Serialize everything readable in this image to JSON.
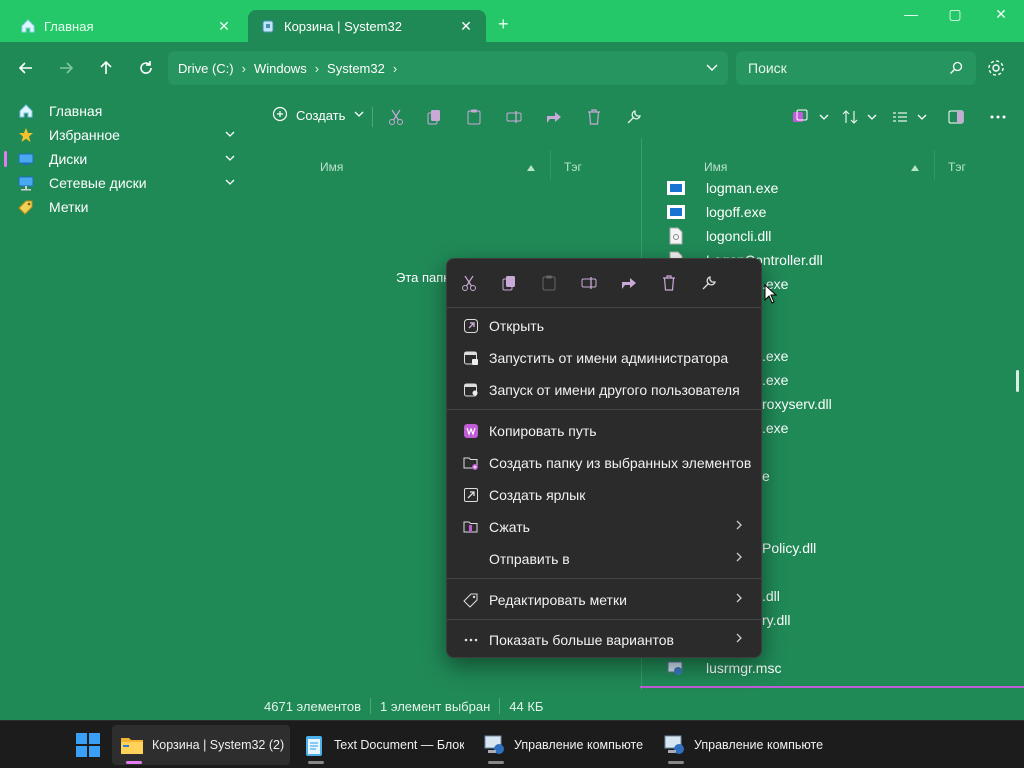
{
  "tabs": [
    {
      "label": "Главная",
      "close": "✕",
      "active": false
    },
    {
      "label": "Корзина | System32",
      "close": "✕",
      "active": true
    }
  ],
  "new_tab": "+",
  "window_buttons": {
    "minimize": "—",
    "maximize": "▢",
    "close": "✕"
  },
  "breadcrumb": [
    "Drive (C:)",
    "Windows",
    "System32"
  ],
  "search": {
    "placeholder": "Поиск"
  },
  "sidebar": {
    "items": [
      {
        "label": "Главная",
        "icon": "home-icon"
      },
      {
        "label": "Избранное",
        "icon": "star-icon",
        "expandable": true
      },
      {
        "label": "Диски",
        "icon": "drive-icon",
        "expandable": true,
        "selected": true
      },
      {
        "label": "Сетевые диски",
        "icon": "network-drive-icon",
        "expandable": true
      },
      {
        "label": "Метки",
        "icon": "tag-icon"
      }
    ]
  },
  "toolbar": {
    "create_label": "Создать"
  },
  "left_pane": {
    "col_name": "Имя",
    "col_tag": "Тэг",
    "empty_text": "Эта папка"
  },
  "right_pane": {
    "col_name": "Имя",
    "col_tag": "Тэг",
    "files": [
      {
        "name": "logman.exe",
        "icon": "exe-icon"
      },
      {
        "name": "logoff.exe",
        "icon": "exe-icon"
      },
      {
        "name": "logoncli.dll",
        "icon": "dll-icon"
      },
      {
        "name": "LogonController.dll",
        "icon": "dll-icon"
      }
    ],
    "partial_names": [
      ".exe",
      ".exe",
      ".exe",
      "roxyserv.dll",
      ".exe",
      "e",
      "Policy.dll",
      ".dll",
      "ry.dll"
    ],
    "last_file": {
      "name": "lusrmgr.msc",
      "icon": "msc-icon"
    }
  },
  "status": {
    "items_count": "4671 элементов",
    "selected": "1 элемент выбран",
    "size": "44 КБ"
  },
  "context_menu": {
    "items": [
      {
        "label": "Открыть",
        "icon": "open-icon"
      },
      {
        "label": "Запустить от имени администратора",
        "icon": "admin-icon"
      },
      {
        "label": "Запуск от имени другого пользователя",
        "icon": "user-run-icon"
      },
      {
        "label": "Копировать путь",
        "icon": "copy-path-icon"
      },
      {
        "label": "Создать папку из выбранных элементов",
        "icon": "new-folder-icon"
      },
      {
        "label": "Создать ярлык",
        "icon": "shortcut-icon"
      },
      {
        "label": "Сжать",
        "icon": "compress-icon",
        "submenu": true
      },
      {
        "label": "Отправить в",
        "icon": "",
        "submenu": true
      },
      {
        "label": "Редактировать метки",
        "icon": "tag-edit-icon",
        "submenu": true
      },
      {
        "label": "Показать больше вариантов",
        "icon": "more-icon",
        "submenu": true
      }
    ]
  },
  "taskbar": {
    "apps": [
      {
        "label": "Корзина | System32 (2)",
        "icon": "file-explorer-icon",
        "active": true
      },
      {
        "label": "Text Document — Блокн",
        "icon": "notepad-icon"
      },
      {
        "label": "Управление компьюте",
        "icon": "computer-management-icon"
      },
      {
        "label": "Управление компьюте",
        "icon": "computer-management-icon"
      }
    ]
  },
  "colors": {
    "accent": "#e27df0",
    "window_bg": "#208a57",
    "title_bg": "#25c869",
    "menu_bg": "#2b2b2b"
  }
}
